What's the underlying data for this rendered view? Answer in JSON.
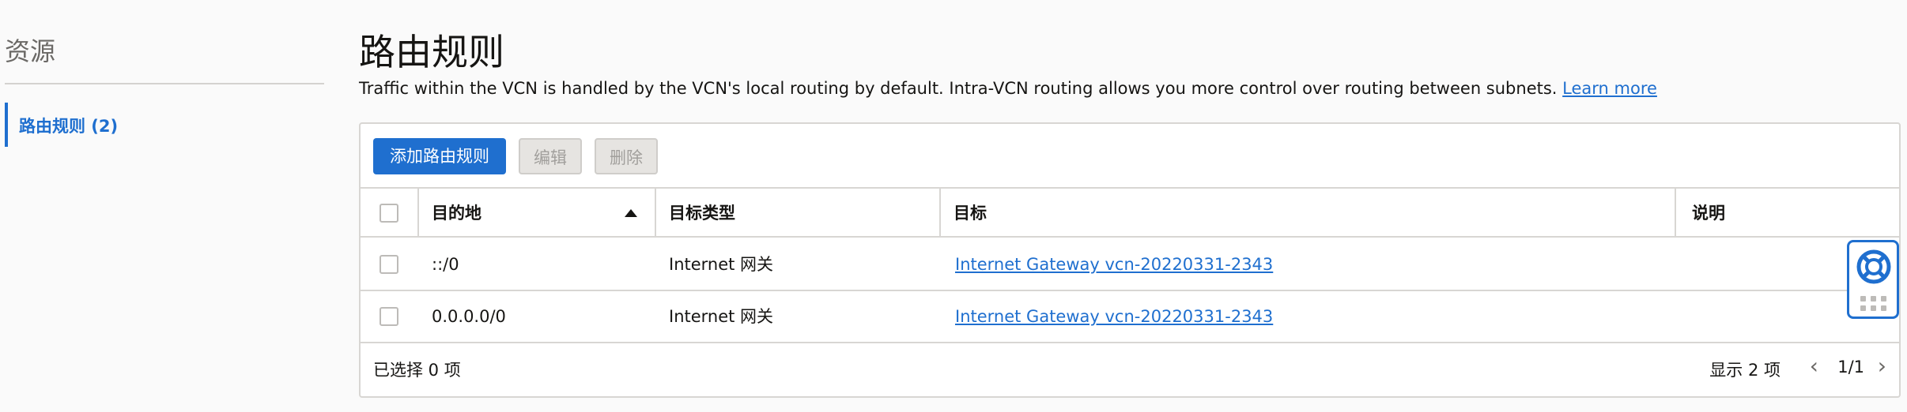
{
  "sidebar": {
    "title": "资源",
    "items": [
      {
        "label": "路由规则 (2)",
        "active": true
      }
    ]
  },
  "main": {
    "title": "路由规则",
    "description": "Traffic within the VCN is handled by the VCN's local routing by default. Intra-VCN routing allows you more control over routing between subnets.",
    "learn_more": "Learn more"
  },
  "toolbar": {
    "add_label": "添加路由规则",
    "edit_label": "编辑",
    "delete_label": "删除"
  },
  "table": {
    "columns": [
      "目的地",
      "目标类型",
      "目标",
      "说明"
    ],
    "sort_column": "目的地",
    "sort_direction": "ascending",
    "rows": [
      {
        "destination": "::/0",
        "target_type": "Internet 网关",
        "target": "Internet Gateway vcn-20220331-2343",
        "description": ""
      },
      {
        "destination": "0.0.0.0/0",
        "target_type": "Internet 网关",
        "target": "Internet Gateway vcn-20220331-2343",
        "description": ""
      }
    ]
  },
  "footer": {
    "selected": "已选择 0 项",
    "showing": "显示 2 项",
    "page": "1/1"
  },
  "colors": {
    "accent": "#1f6fcf",
    "background": "#fafafa",
    "border": "#d8d6d3",
    "disabled_bg": "#e6e4e1"
  },
  "icons": {
    "help": "lifebuoy-icon",
    "sort": "sort-ascending-icon",
    "prev": "chevron-left-icon",
    "next": "chevron-right-icon"
  }
}
